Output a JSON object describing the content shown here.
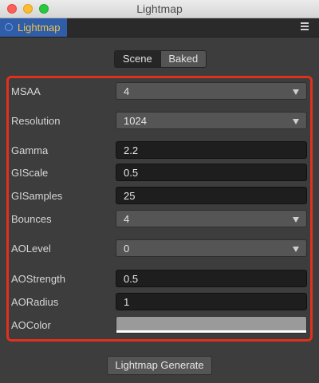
{
  "window": {
    "title": "Lightmap"
  },
  "panel_tab": {
    "label": "Lightmap"
  },
  "mode_tabs": {
    "scene": "Scene",
    "baked": "Baked",
    "active": "scene"
  },
  "properties": {
    "msaa": {
      "label": "MSAA",
      "value": "4"
    },
    "resolution": {
      "label": "Resolution",
      "value": "1024"
    },
    "gamma": {
      "label": "Gamma",
      "value": "2.2"
    },
    "giscale": {
      "label": "GIScale",
      "value": "0.5"
    },
    "gisamples": {
      "label": "GISamples",
      "value": "25"
    },
    "bounces": {
      "label": "Bounces",
      "value": "4"
    },
    "aolevel": {
      "label": "AOLevel",
      "value": "0"
    },
    "aostrength": {
      "label": "AOStrength",
      "value": "0.5"
    },
    "aoradius": {
      "label": "AORadius",
      "value": "1"
    },
    "aocolor": {
      "label": "AOColor",
      "color": "#9a9a9a"
    }
  },
  "generate_button": {
    "label": "Lightmap Generate"
  },
  "colors": {
    "highlight_border": "#e0301e",
    "tab_bg": "#2f5da8",
    "tab_text": "#f2c34b"
  }
}
